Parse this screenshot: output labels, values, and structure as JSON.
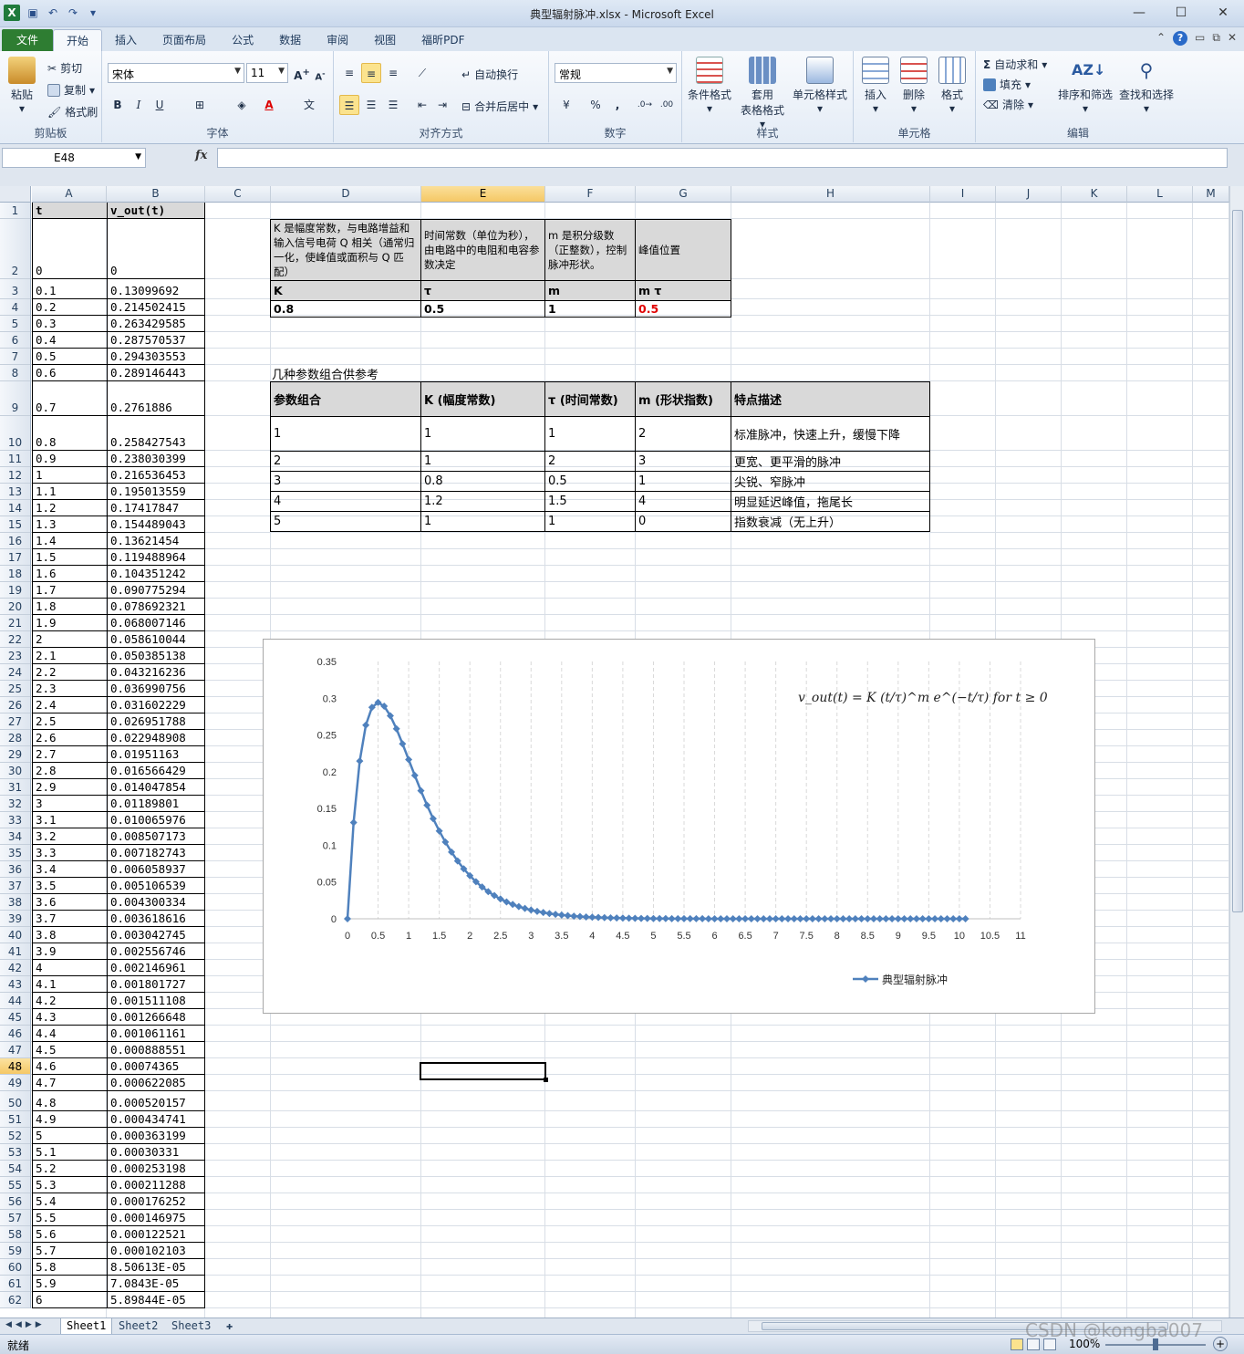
{
  "window": {
    "title": "典型辐射脉冲.xlsx - Microsoft Excel"
  },
  "ribbon": {
    "tabs": [
      "文件",
      "开始",
      "插入",
      "页面布局",
      "公式",
      "数据",
      "审阅",
      "视图",
      "福昕PDF"
    ],
    "active_tab": "开始",
    "clipboard": {
      "paste": "粘贴",
      "cut": "剪切",
      "copy": "复制",
      "format_painter": "格式刷",
      "label": "剪贴板"
    },
    "font": {
      "name": "宋体",
      "size": "11",
      "bold": "B",
      "italic": "I",
      "underline": "U",
      "label": "字体"
    },
    "alignment": {
      "wrap": "自动换行",
      "merge": "合并后居中",
      "label": "对齐方式"
    },
    "number": {
      "format": "常规",
      "percent": "%",
      "comma": ",",
      "label": "数字"
    },
    "styles": {
      "conditional": "条件格式",
      "table_fmt_1": "套用",
      "table_fmt_2": "表格格式",
      "cell_styles": "单元格样式",
      "label": "样式"
    },
    "cells": {
      "insert": "插入",
      "delete": "删除",
      "format": "格式",
      "label": "单元格"
    },
    "editing": {
      "autosum": "自动求和",
      "fill": "填充",
      "clear": "清除",
      "sort": "排序和筛选",
      "find": "查找和选择",
      "label": "编辑"
    }
  },
  "formula_bar": {
    "name_box": "E48",
    "fx": "fx",
    "value": ""
  },
  "columns": [
    "A",
    "B",
    "C",
    "D",
    "E",
    "F",
    "G",
    "H",
    "I",
    "J",
    "K",
    "L",
    "M"
  ],
  "selected_column": "E",
  "selected_row": "48",
  "data_table": {
    "header": [
      "t",
      "v_out(t)"
    ],
    "rows": [
      [
        "0",
        "0"
      ],
      [
        "0.1",
        "0.13099692"
      ],
      [
        "0.2",
        "0.214502415"
      ],
      [
        "0.3",
        "0.263429585"
      ],
      [
        "0.4",
        "0.287570537"
      ],
      [
        "0.5",
        "0.294303553"
      ],
      [
        "0.6",
        "0.289146443"
      ],
      [
        "0.7",
        "0.2761886"
      ],
      [
        "0.8",
        "0.258427543"
      ],
      [
        "0.9",
        "0.238030399"
      ],
      [
        "1",
        "0.216536453"
      ],
      [
        "1.1",
        "0.195013559"
      ],
      [
        "1.2",
        "0.17417847"
      ],
      [
        "1.3",
        "0.154489043"
      ],
      [
        "1.4",
        "0.13621454"
      ],
      [
        "1.5",
        "0.119488964"
      ],
      [
        "1.6",
        "0.104351242"
      ],
      [
        "1.7",
        "0.090775294"
      ],
      [
        "1.8",
        "0.078692321"
      ],
      [
        "1.9",
        "0.068007146"
      ],
      [
        "2",
        "0.058610044"
      ],
      [
        "2.1",
        "0.050385138"
      ],
      [
        "2.2",
        "0.043216236"
      ],
      [
        "2.3",
        "0.036990756"
      ],
      [
        "2.4",
        "0.031602229"
      ],
      [
        "2.5",
        "0.026951788"
      ],
      [
        "2.6",
        "0.022948908"
      ],
      [
        "2.7",
        "0.01951163"
      ],
      [
        "2.8",
        "0.016566429"
      ],
      [
        "2.9",
        "0.014047854"
      ],
      [
        "3",
        "0.01189801"
      ],
      [
        "3.1",
        "0.010065976"
      ],
      [
        "3.2",
        "0.008507173"
      ],
      [
        "3.3",
        "0.007182743"
      ],
      [
        "3.4",
        "0.006058937"
      ],
      [
        "3.5",
        "0.005106539"
      ],
      [
        "3.6",
        "0.004300334"
      ],
      [
        "3.7",
        "0.003618616"
      ],
      [
        "3.8",
        "0.003042745"
      ],
      [
        "3.9",
        "0.002556746"
      ],
      [
        "4",
        "0.002146961"
      ],
      [
        "4.1",
        "0.001801727"
      ],
      [
        "4.2",
        "0.001511108"
      ],
      [
        "4.3",
        "0.001266648"
      ],
      [
        "4.4",
        "0.001061161"
      ],
      [
        "4.5",
        "0.000888551"
      ],
      [
        "4.6",
        "0.00074365"
      ],
      [
        "4.7",
        "0.000622085"
      ],
      [
        "4.8",
        "0.000520157"
      ],
      [
        "4.9",
        "0.000434741"
      ],
      [
        "5",
        "0.000363199"
      ],
      [
        "5.1",
        "0.00030331"
      ],
      [
        "5.2",
        "0.000253198"
      ],
      [
        "5.3",
        "0.000211288"
      ],
      [
        "5.4",
        "0.000176252"
      ],
      [
        "5.5",
        "0.000146975"
      ],
      [
        "5.6",
        "0.000122521"
      ],
      [
        "5.7",
        "0.000102103"
      ],
      [
        "5.8",
        "8.50613E-05"
      ],
      [
        "5.9",
        "7.0843E-05"
      ],
      [
        "6",
        "5.89844E-05"
      ]
    ]
  },
  "param_table": {
    "desc": [
      "K 是幅度常数，与电路增益和输入信号电荷 Q 相关（通常归一化，使峰值或面积与 Q 匹配）",
      "时间常数（单位为秒），由电路中的电阻和电容参数决定",
      "m 是积分级数（正整数），控制脉冲形状。",
      "峰值位置"
    ],
    "names": [
      "K",
      "τ",
      "m",
      "m τ"
    ],
    "values": [
      "0.8",
      "0.5",
      "1",
      "0.5"
    ]
  },
  "combo_title": "几种参数组合供参考",
  "combo_table": {
    "header": [
      "参数组合",
      "K (幅度常数)",
      "τ (时间常数)",
      "m (形状指数)",
      "特点描述"
    ],
    "rows": [
      [
        "1",
        "1",
        "1",
        "2",
        "标准脉冲，快速上升，缓慢下降"
      ],
      [
        "2",
        "1",
        "2",
        "3",
        "更宽、更平滑的脉冲"
      ],
      [
        "3",
        "0.8",
        "0.5",
        "1",
        "尖锐、窄脉冲"
      ],
      [
        "4",
        "1.2",
        "1.5",
        "4",
        "明显延迟峰值，拖尾长"
      ],
      [
        "5",
        "1",
        "1",
        "0",
        "指数衰减（无上升）"
      ]
    ]
  },
  "chart_data": {
    "type": "line",
    "title": "",
    "formula_annotation": "v_out(t) = K (t/τ)^m e^(−t/τ)   for t ≥ 0",
    "x": [
      0,
      0.1,
      0.2,
      0.3,
      0.4,
      0.5,
      0.6,
      0.7,
      0.8,
      0.9,
      1,
      1.1,
      1.2,
      1.3,
      1.4,
      1.5,
      1.6,
      1.7,
      1.8,
      1.9,
      2,
      2.1,
      2.2,
      2.3,
      2.4,
      2.5,
      2.6,
      2.7,
      2.8,
      2.9,
      3,
      3.1,
      3.2,
      3.3,
      3.4,
      3.5,
      3.6,
      3.7,
      3.8,
      3.9,
      4,
      4.1,
      4.2,
      4.3,
      4.4,
      4.5,
      4.6,
      4.7,
      4.8,
      4.9,
      5,
      5.1,
      5.2,
      5.3,
      5.4,
      5.5,
      5.6,
      5.7,
      5.8,
      5.9,
      6,
      6.1,
      6.2,
      6.3,
      6.4,
      6.5,
      6.6,
      6.7,
      6.8,
      6.9,
      7,
      7.1,
      7.2,
      7.3,
      7.4,
      7.5,
      7.6,
      7.7,
      7.8,
      7.9,
      8,
      8.1,
      8.2,
      8.3,
      8.4,
      8.5,
      8.6,
      8.7,
      8.8,
      8.9,
      9,
      9.1,
      9.2,
      9.3,
      9.4,
      9.5,
      9.6,
      9.7,
      9.8,
      9.9,
      10,
      10.1
    ],
    "series": [
      {
        "name": "典型辐射脉冲",
        "color": "#4f81bd",
        "values": [
          0,
          0.13099692,
          0.214502415,
          0.263429585,
          0.287570537,
          0.294303553,
          0.289146443,
          0.2761886,
          0.258427543,
          0.238030399,
          0.216536453,
          0.195013559,
          0.17417847,
          0.154489043,
          0.13621454,
          0.119488964,
          0.104351242,
          0.090775294,
          0.078692321,
          0.068007146,
          0.058610044,
          0.050385138,
          0.043216236,
          0.036990756,
          0.031602229,
          0.026951788,
          0.022948908,
          0.01951163,
          0.016566429,
          0.014047854,
          0.01189801,
          0.010065976,
          0.008507173,
          0.007182743,
          0.006058937,
          0.005106539,
          0.004300334,
          0.003618616,
          0.003042745,
          0.002556746,
          0.002146961,
          0.001801727,
          0.001511108,
          0.001266648,
          0.001061161,
          0.000888551,
          0.00074365,
          0.000622085,
          0.000520157,
          0.000434741,
          0.000363199,
          0.00030331,
          0.000253198,
          0.000211288,
          0.000176252,
          0.000146975,
          0.000122521,
          0.000102103,
          8.50613e-05,
          7.0843e-05,
          5.89844e-05,
          4.91e-05,
          4.09e-05,
          3.4e-05,
          2.83e-05,
          2.35e-05,
          1.96e-05,
          1.63e-05,
          1.35e-05,
          1.12e-05,
          9.4e-06,
          7.8e-06,
          6.4e-06,
          5.4e-06,
          4.5e-06,
          3.7e-06,
          3.1e-06,
          2.6e-06,
          2.1e-06,
          1.8e-06,
          1.5e-06,
          1.2e-06,
          1e-06,
          8e-07,
          7e-07,
          6e-07,
          5e-07,
          4e-07,
          3e-07,
          3e-07,
          2e-07,
          2e-07,
          2e-07,
          1e-07,
          1e-07,
          1e-07,
          1e-07,
          1e-07,
          1e-07,
          0,
          0,
          0
        ]
      }
    ],
    "xticks": [
      "0",
      "0.5",
      "1",
      "1.5",
      "2",
      "2.5",
      "3",
      "3.5",
      "4",
      "4.5",
      "5",
      "5.5",
      "6",
      "6.5",
      "7",
      "7.5",
      "8",
      "8.5",
      "9",
      "9.5",
      "10",
      "10.5",
      "11"
    ],
    "yticks": [
      "0",
      "0.05",
      "0.1",
      "0.15",
      "0.2",
      "0.25",
      "0.3",
      "0.35"
    ],
    "xlim": [
      0,
      11
    ],
    "ylim": [
      0,
      0.35
    ],
    "grid": "vertical dashed",
    "legend": "bottom-right"
  },
  "sheets": [
    "Sheet1",
    "Sheet2",
    "Sheet3"
  ],
  "active_sheet": "Sheet1",
  "status": {
    "ready": "就绪",
    "zoom": "100%"
  },
  "watermark": "CSDN @kongba007"
}
